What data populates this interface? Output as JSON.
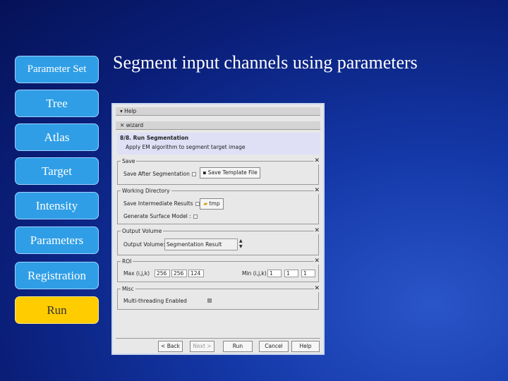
{
  "nav": [
    "Parameter Set",
    "Tree",
    "Atlas",
    "Target",
    "Intensity",
    "Parameters",
    "Registration",
    "Run"
  ],
  "title": "Segment input channels using parameters",
  "dialog": {
    "help": "Help",
    "wizard": "wizard",
    "step": "8/8. Run Segmentation",
    "step_desc": "Apply EM algorithm to segment target image",
    "save": {
      "label": "Save",
      "after": "Save After Segmentation",
      "template_btn": "Save Template File"
    },
    "workdir": {
      "label": "Working Directory",
      "intermediate": "Save Intermediate Results",
      "dir_btn": "tmp",
      "surface": "Generate Surface Model :"
    },
    "output": {
      "label": "Output Volume",
      "field": "Output Volume:",
      "value": "Segmentation Result"
    },
    "roi": {
      "label": "ROI",
      "max": "Max (i,j,k)",
      "max_vals": [
        "256",
        "256",
        "124"
      ],
      "min": "Min (i,j,k)",
      "min_vals": [
        "1",
        "1",
        "1"
      ]
    },
    "misc": {
      "label": "Misc",
      "multithread": "Multi-threading Enabled"
    },
    "buttons": {
      "back": "< Back",
      "next": "Next >",
      "run": "Run",
      "cancel": "Cancel",
      "help": "Help"
    },
    "close": "✕"
  }
}
